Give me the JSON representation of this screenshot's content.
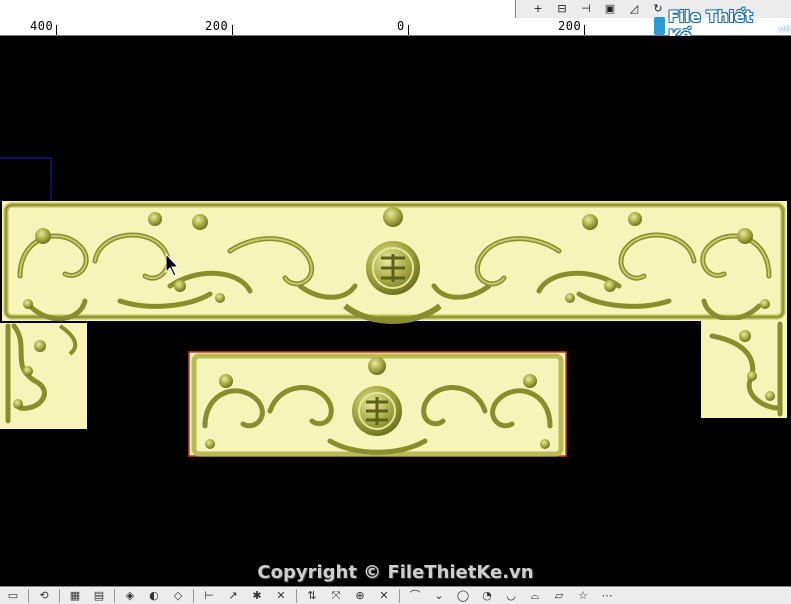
{
  "ruler": {
    "labels": [
      "400",
      "200",
      "0",
      "200"
    ]
  },
  "watermark": {
    "logo_text": "File Thiết Kế",
    "logo_domain": ".vn"
  },
  "footer": {
    "copyright": "Copyright © FileThietKe.vn"
  },
  "toolbar_top": {
    "icons": [
      "plus-icon",
      "move-icon",
      "align-icon",
      "frame-icon",
      "corner-icon",
      "rotate-icon"
    ],
    "glyphs": [
      "+",
      "⊟",
      "⊣",
      "▣",
      "◿",
      "↻"
    ]
  },
  "toolbar_bottom": {
    "glyphs": [
      "▭",
      "⟲",
      "▦",
      "▤",
      "◈",
      "◐",
      "◇",
      "⊢",
      "↗",
      "✱",
      "✕",
      "⇅",
      "⤧",
      "⊕",
      "✕",
      "⌒",
      "⌄",
      "◯",
      "◔",
      "◡",
      "⌓",
      "▱",
      "☆",
      "⋯"
    ]
  },
  "colors": {
    "carving": "#f6f4b8",
    "carving_dark": "#8a8d2e",
    "carving_mid": "#b9bb55",
    "selection": "#1b1bd0",
    "outline": "#d23a2a"
  }
}
